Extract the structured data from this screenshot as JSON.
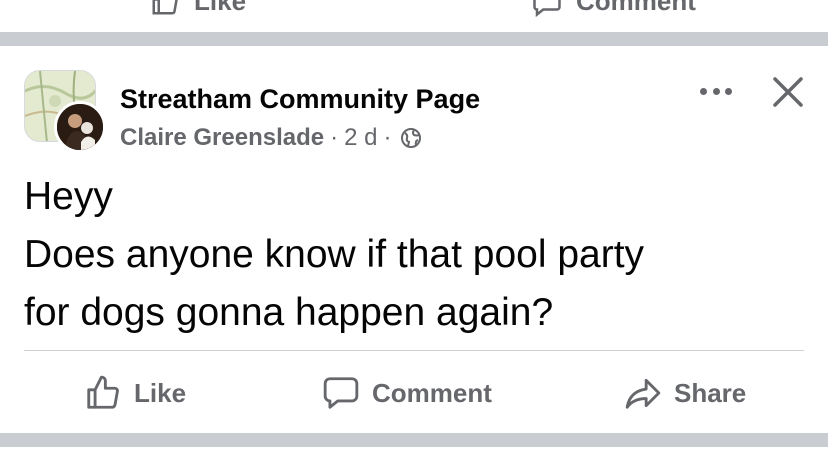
{
  "post": {
    "group_name": "Streatham Community Page",
    "author": "Claire Greenslade",
    "separator": "·",
    "time": "2 d",
    "privacy_icon": "globe-icon",
    "body_lines": [
      "Heyy",
      "Does anyone know if that pool party",
      "for dogs gonna happen again?"
    ]
  },
  "actions": {
    "like_label": "Like",
    "comment_label": "Comment",
    "share_label": "Share"
  },
  "prev_actions": {
    "like_label": "Like",
    "comment_label": "Comment"
  },
  "colors": {
    "text": "#050505",
    "secondary_text": "#65676b",
    "divider_band": "#c9ccd1"
  }
}
